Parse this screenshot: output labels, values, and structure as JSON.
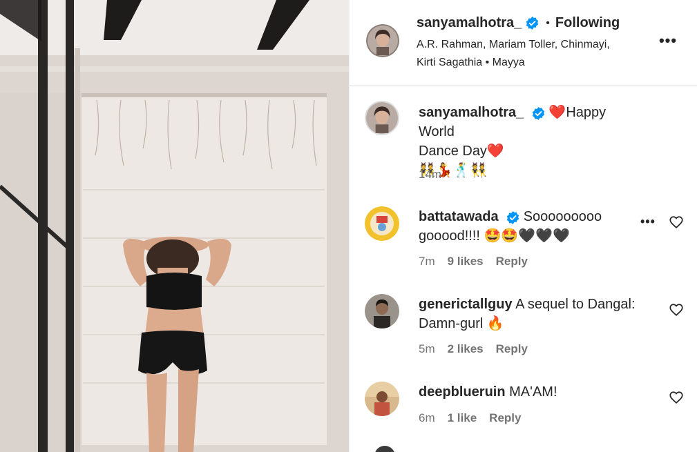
{
  "post": {
    "header": {
      "username": "sanyamalhotra_",
      "separator": "•",
      "follow_status": "Following",
      "audio_line1": "A.R. Rahman, Mariam Toller, Chinmayi,",
      "audio_line2": "Kirti Sagathia • Mayya",
      "more_glyph": "•••"
    },
    "caption": {
      "username": "sanyamalhotra_",
      "text_line1": "❤️Happy World",
      "text_line2": "Dance Day❤️",
      "emojis": "👯💃🕺👯",
      "time": "14m"
    },
    "comments": [
      {
        "username": "battatawada",
        "verified": true,
        "text": "Sooooooooo gooood!!!! 🤩🤩🖤🖤🖤",
        "time": "7m",
        "likes": "9 likes",
        "reply": "Reply"
      },
      {
        "username": "generictallguy",
        "verified": false,
        "text": "A sequel to Dangal: Damn-gurl 🔥",
        "time": "5m",
        "likes": "2 likes",
        "reply": "Reply"
      },
      {
        "username": "deepblueruin",
        "verified": false,
        "text": "MA'AM!",
        "time": "6m",
        "likes": "1 like",
        "reply": "Reply"
      }
    ]
  },
  "icons": {
    "verified": "verified-badge-icon",
    "heart": "heart-outline-icon",
    "more": "more-horizontal-icon"
  },
  "colors": {
    "verified_blue": "#0095f6",
    "text": "#262626",
    "secondary": "#737373",
    "divider": "#dbdbdb"
  }
}
